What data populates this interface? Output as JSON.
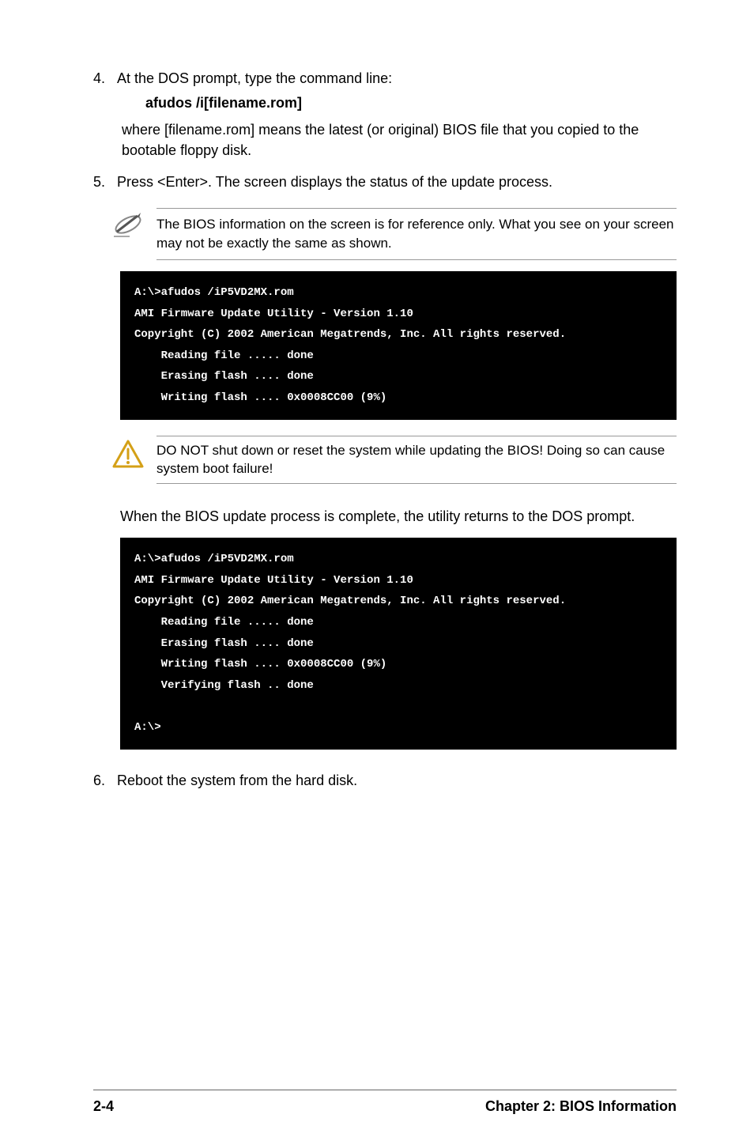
{
  "steps": {
    "s4_num": "4.",
    "s4_text": "At the DOS prompt, type the command line:",
    "s4_bold": "afudos /i[filename.rom]",
    "s4_where": "where [filename.rom] means the latest (or original) BIOS file that you copied to the bootable floppy disk.",
    "s5_num": "5.",
    "s5_text": "Press <Enter>. The screen displays the status of the update process.",
    "s6_num": "6.",
    "s6_text": "Reboot the system from the hard disk."
  },
  "note": {
    "text": "The BIOS information on the screen is for reference only. What you see on your screen may not be exactly the same as shown."
  },
  "warning": {
    "text": "DO NOT shut down or reset the system while updating the BIOS! Doing so can cause system boot failure!"
  },
  "terminal1": "A:\\>afudos /iP5VD2MX.rom\nAMI Firmware Update Utility - Version 1.10\nCopyright (C) 2002 American Megatrends, Inc. All rights reserved.\n    Reading file ..... done\n    Erasing flash .... done\n    Writing flash .... 0x0008CC00 (9%)",
  "terminal2": "A:\\>afudos /iP5VD2MX.rom\nAMI Firmware Update Utility - Version 1.10\nCopyright (C) 2002 American Megatrends, Inc. All rights reserved.\n    Reading file ..... done\n    Erasing flash .... done\n    Writing flash .... 0x0008CC00 (9%)\n    Verifying flash .. done\n\nA:\\>",
  "para_complete": "When the BIOS update process is complete, the utility returns to the DOS prompt.",
  "footer": {
    "left": "2-4",
    "right": "Chapter 2: BIOS Information"
  }
}
